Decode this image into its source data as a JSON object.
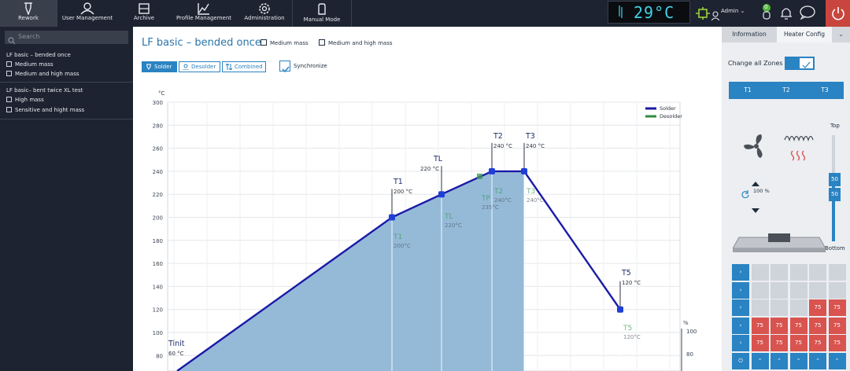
{
  "topbar": {
    "nav": [
      {
        "label": "Rework",
        "icon": "soldering-iron-icon"
      },
      {
        "label": "User Management",
        "icon": "users-icon"
      },
      {
        "label": "Archive",
        "icon": "archive-icon"
      },
      {
        "label": "Profile Management",
        "icon": "profile-chart-icon"
      },
      {
        "label": "Administration",
        "icon": "gear-icon"
      },
      {
        "label": "Manual Mode",
        "icon": "hand-icon"
      }
    ],
    "temperature": "29°C",
    "notification_count": "0",
    "user": "Admin"
  },
  "sidebar": {
    "search_placeholder": "Search",
    "groups": [
      {
        "title": "LF basic – bended once",
        "items": [
          "Medium mass",
          "Medium and high mass"
        ]
      },
      {
        "title": "LF basic– bent twice XL test",
        "items": [
          "High mass",
          "Sensitive and hight mass"
        ]
      }
    ]
  },
  "main": {
    "title": "LF basic – bended once",
    "mass_tabs": [
      "Medium mass",
      "Medium and high mass"
    ],
    "modes": [
      "Solder",
      "Desolder",
      "Combined"
    ],
    "sync_label": "Synchronize"
  },
  "chart_data": {
    "type": "area",
    "ylabel": "°C",
    "y_ticks": [
      80,
      100,
      120,
      140,
      160,
      180,
      200,
      220,
      240,
      260,
      280,
      300
    ],
    "legend": [
      {
        "name": "Solder",
        "color": "#1a1aa6"
      },
      {
        "name": "Desolder",
        "color": "#2e8b3e"
      }
    ],
    "solder_points": [
      {
        "label": "Tinit",
        "value": "60 °C",
        "y": 60
      },
      {
        "label": "T1",
        "value": "200 °C",
        "y": 200
      },
      {
        "label": "TL",
        "value": "220 °C",
        "y": 220
      },
      {
        "label": "T2",
        "value": "240 °C",
        "y": 240
      },
      {
        "label": "T3",
        "value": "240 °C",
        "y": 240
      },
      {
        "label": "T5",
        "value": "120 °C",
        "y": 120
      }
    ],
    "desolder_labels": [
      {
        "label": "T1",
        "value": "200°C"
      },
      {
        "label": "TL",
        "value": "220°C"
      },
      {
        "label": "TP",
        "value": "235°C"
      },
      {
        "label": "T2",
        "value": "240°C"
      },
      {
        "label": "T3",
        "value": "240°C"
      },
      {
        "label": "T5",
        "value": "120°C"
      }
    ],
    "secondary_axis": {
      "label": "%",
      "ticks": [
        100,
        80
      ]
    },
    "colors": {
      "fill": "#8fb6d6",
      "line": "#1a1aa6",
      "marker": "#1f3fd6"
    }
  },
  "right_panel": {
    "tabs": [
      "Information",
      "Heater Config"
    ],
    "change_zones_label": "Change all Zones",
    "zones": [
      "T1",
      "T2",
      "T3"
    ],
    "top_label": "Top",
    "bottom_label": "Bottom",
    "fan_percent": "100 %",
    "heater_value_top": "50",
    "heater_value_bottom": "50",
    "grid_value": "75"
  }
}
